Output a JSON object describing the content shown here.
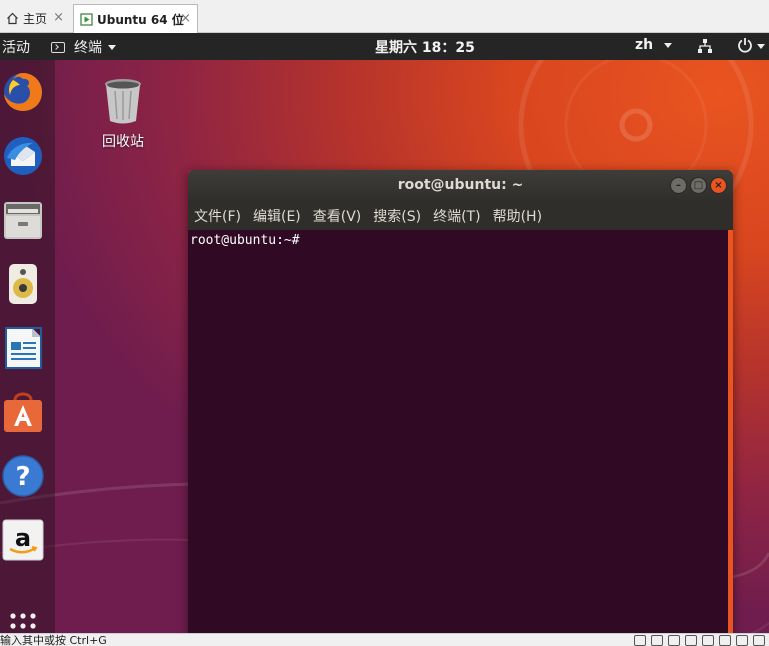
{
  "vm_tabs": {
    "home_label": "主页",
    "active_label": "Ubuntu 64 位",
    "close_glyph": "×"
  },
  "topbar": {
    "activities": "活动",
    "app_name": "终端",
    "clock": "星期六 18：25",
    "language": "zh"
  },
  "dock": {
    "items": [
      "firefox-icon",
      "thunderbird-icon",
      "files-icon",
      "rhythmbox-icon",
      "libreoffice-writer-icon",
      "ubuntu-software-icon",
      "help-icon",
      "amazon-icon",
      "show-apps-icon"
    ]
  },
  "desktop": {
    "trash_label": "回收站"
  },
  "terminal": {
    "title": "root@ubuntu: ~",
    "menus": [
      "文件(F)",
      "编辑(E)",
      "查看(V)",
      "搜索(S)",
      "终端(T)",
      "帮助(H)"
    ],
    "prompt": "root@ubuntu:~#"
  },
  "statusbar": {
    "hint": "输入其中或按 Ctrl+G"
  },
  "colors": {
    "accent": "#e95420",
    "terminal_bg": "#300a24",
    "topbar_bg": "#252525"
  }
}
